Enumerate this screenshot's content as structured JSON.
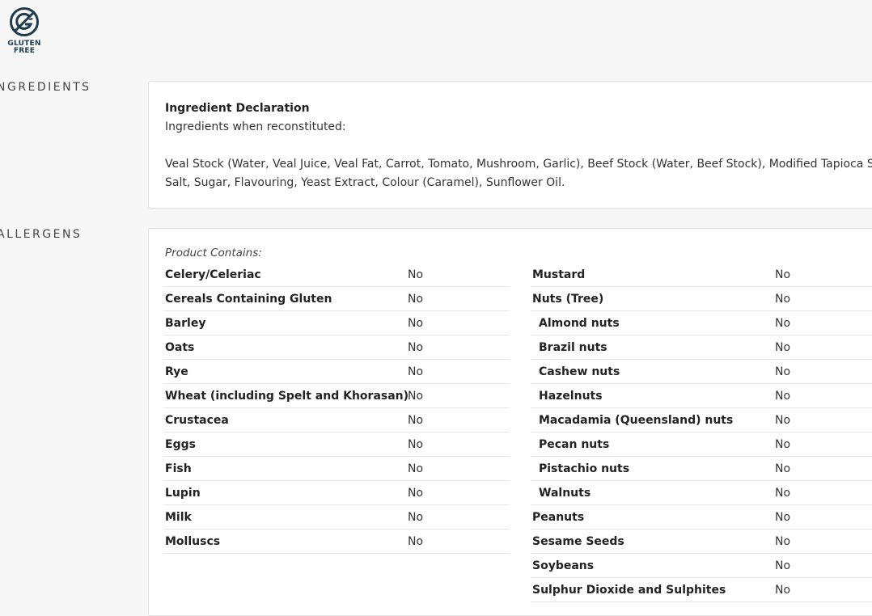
{
  "badge": {
    "icon": "gluten-free-icon",
    "line1": "GLUTEN",
    "line2": "FREE",
    "color": "#1e3a4c"
  },
  "sections": {
    "ingredients": "NGREDIENTS",
    "allergens": "ALLERGENS"
  },
  "ingredients": {
    "title": "Ingredient Declaration",
    "subtitle": "Ingredients when reconstituted:",
    "line1": "Veal Stock (Water, Veal Juice, Veal Fat, Carrot, Tomato, Mushroom, Garlic), Beef Stock (Water, Beef Stock), Modified Tapioca Starch,",
    "line2": "Salt, Sugar, Flavouring, Yeast Extract, Colour (Caramel), Sunflower Oil."
  },
  "allergens": {
    "contains_label": "Product Contains:",
    "left": [
      {
        "name": "Celery/Celeriac",
        "value": "No"
      },
      {
        "name": "Cereals Containing Gluten",
        "value": "No"
      },
      {
        "name": "Barley",
        "value": "No"
      },
      {
        "name": "Oats",
        "value": "No"
      },
      {
        "name": "Rye",
        "value": "No"
      },
      {
        "name": "Wheat (including Spelt and Khorasan)",
        "value": "No"
      },
      {
        "name": "Crustacea",
        "value": "No"
      },
      {
        "name": "Eggs",
        "value": "No"
      },
      {
        "name": "Fish",
        "value": "No"
      },
      {
        "name": "Lupin",
        "value": "No"
      },
      {
        "name": "Milk",
        "value": "No"
      },
      {
        "name": "Molluscs",
        "value": "No"
      }
    ],
    "right": [
      {
        "name": "Mustard",
        "value": "No",
        "sub": false
      },
      {
        "name": "Nuts (Tree)",
        "value": "No",
        "sub": false
      },
      {
        "name": "Almond nuts",
        "value": "No",
        "sub": true
      },
      {
        "name": "Brazil nuts",
        "value": "No",
        "sub": true
      },
      {
        "name": "Cashew nuts",
        "value": "No",
        "sub": true
      },
      {
        "name": "Hazelnuts",
        "value": "No",
        "sub": true
      },
      {
        "name": "Macadamia (Queensland) nuts",
        "value": "No",
        "sub": true
      },
      {
        "name": "Pecan nuts",
        "value": "No",
        "sub": true
      },
      {
        "name": "Pistachio nuts",
        "value": "No",
        "sub": true
      },
      {
        "name": "Walnuts",
        "value": "No",
        "sub": true
      },
      {
        "name": "Peanuts",
        "value": "No",
        "sub": false
      },
      {
        "name": "Sesame Seeds",
        "value": "No",
        "sub": false
      },
      {
        "name": "Soybeans",
        "value": "No",
        "sub": false
      },
      {
        "name": "Sulphur Dioxide and Sulphites",
        "value": "No",
        "sub": false
      }
    ]
  }
}
